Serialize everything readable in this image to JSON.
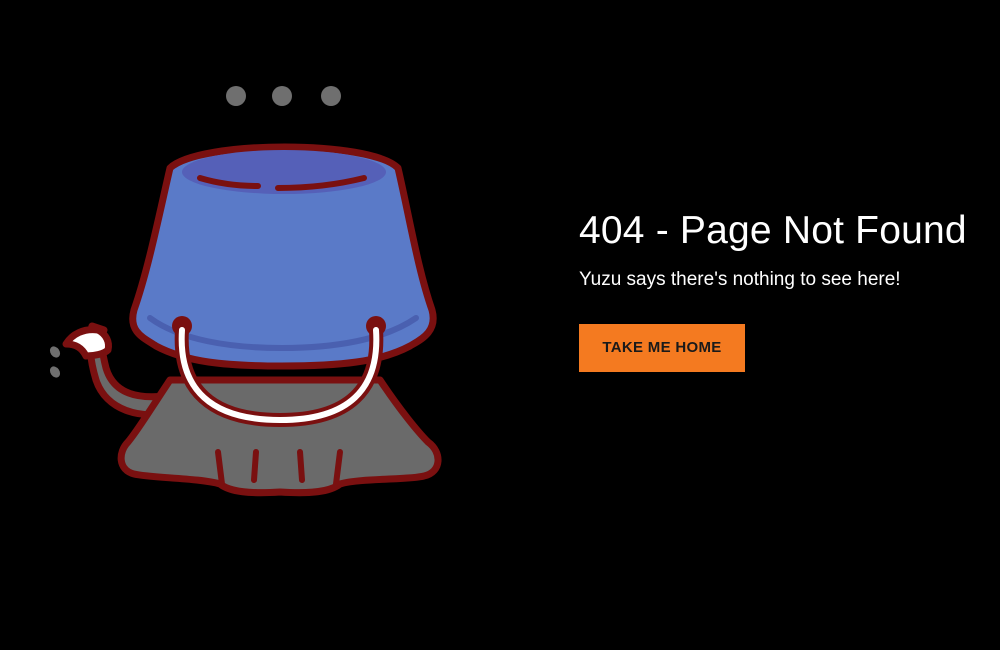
{
  "page": {
    "title": "404 - Page Not Found",
    "subtitle": "Yuzu says there's nothing to see here!",
    "button_label": "TAKE ME HOME"
  },
  "illustration": {
    "subject": "cat-with-bucket-on-head",
    "dots": 3
  },
  "colors": {
    "background": "#000000",
    "text": "#ffffff",
    "button": "#f47a20",
    "bucket": "#5a7ac8",
    "outline": "#7a1010",
    "cat": "#6a6a6a"
  }
}
